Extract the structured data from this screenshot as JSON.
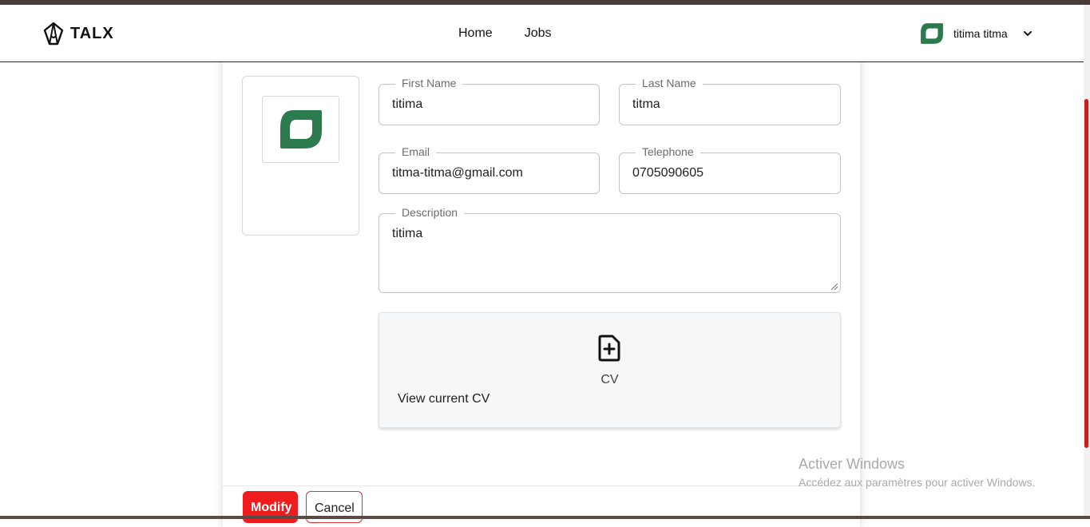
{
  "header": {
    "brand": "TALX",
    "nav": [
      "Home",
      "Jobs"
    ],
    "user": {
      "name": "titima titma"
    }
  },
  "form": {
    "first_name": {
      "label": "First Name",
      "value": "titima"
    },
    "last_name": {
      "label": "Last Name",
      "value": "titma"
    },
    "email": {
      "label": "Email",
      "value": "titma-titma@gmail.com"
    },
    "telephone": {
      "label": "Telephone",
      "value": "0705090605"
    },
    "description": {
      "label": "Description",
      "value": "titima"
    },
    "cv": {
      "label": "CV",
      "link": "View current CV"
    }
  },
  "actions": {
    "modify": "Modify",
    "cancel": "Cancel"
  },
  "watermark": {
    "title": "Activer Windows",
    "subtitle": "Accédez aux paramètres pour activer Windows."
  },
  "colors": {
    "accent": "#ee1c1c",
    "logo_green": "#2e7a4f",
    "scrollbar": "#c81e1e"
  }
}
